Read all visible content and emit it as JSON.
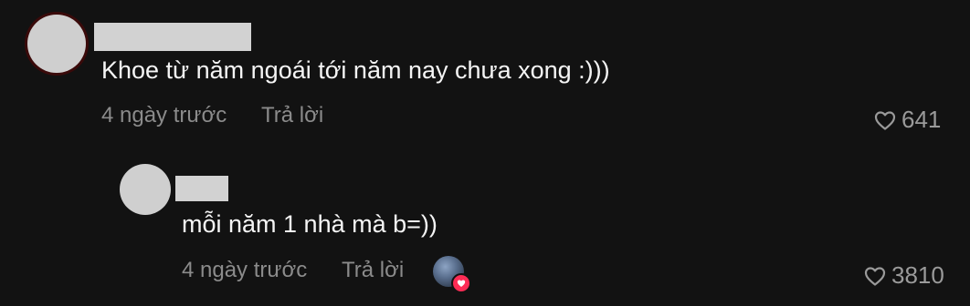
{
  "comment": {
    "text": "Khoe từ năm ngoái tới năm nay chưa xong :)))",
    "time": "4 ngày trước",
    "reply_label": "Trả lời",
    "likes": "641"
  },
  "reply": {
    "text": "mỗi năm 1 nhà mà b=))",
    "time": "4 ngày trước",
    "reply_label": "Trả lời",
    "likes": "3810",
    "creator_liked_icon": "heart-badge-icon"
  },
  "colors": {
    "background": "#121212",
    "text": "#f5f5f5",
    "meta": "#8b8b8b",
    "heart_badge": "#fe2c55"
  }
}
